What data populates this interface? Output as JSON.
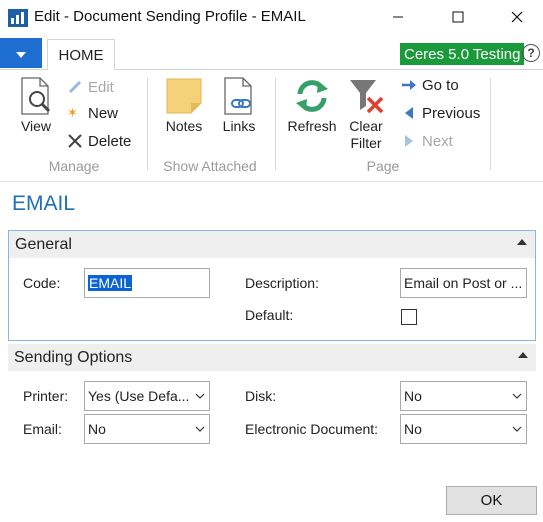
{
  "window": {
    "title": "Edit - Document Sending Profile - EMAIL",
    "icons": [
      "app-chart-icon",
      "minimize-icon",
      "maximize-icon",
      "close-icon"
    ]
  },
  "ribbon_tabs": {
    "home_label": "HOME",
    "company_badge": "Ceres 5.0 Testing",
    "help_glyph": "?"
  },
  "ribbon": {
    "manage": {
      "group_label": "Manage",
      "view": "View",
      "edit": "Edit",
      "new": "New",
      "delete": "Delete"
    },
    "show_attached": {
      "group_label": "Show Attached",
      "notes": "Notes",
      "links": "Links"
    },
    "page": {
      "group_label": "Page",
      "refresh": "Refresh",
      "clear_filter_line1": "Clear",
      "clear_filter_line2": "Filter",
      "go_to": "Go to",
      "previous": "Previous",
      "next": "Next"
    }
  },
  "page_title": "EMAIL",
  "general": {
    "header": "General",
    "code_label": "Code:",
    "code_value": "EMAIL",
    "description_label": "Description:",
    "description_value": "Email on Post or ...",
    "default_label": "Default:",
    "default_checked": false
  },
  "sending_options": {
    "header": "Sending Options",
    "printer_label": "Printer:",
    "printer_value": "Yes (Use Defa...",
    "email_label": "Email:",
    "email_value": "No",
    "disk_label": "Disk:",
    "disk_value": "No",
    "electronic_label": "Electronic Document:",
    "electronic_value": "No"
  },
  "ok_label": "OK",
  "colors": {
    "accent": "#1e6fd1",
    "title_blue": "#1e6fb8",
    "badge_green": "#1a9a3a",
    "general_border": "#8bb4e6",
    "selection": "#0a64d8"
  }
}
